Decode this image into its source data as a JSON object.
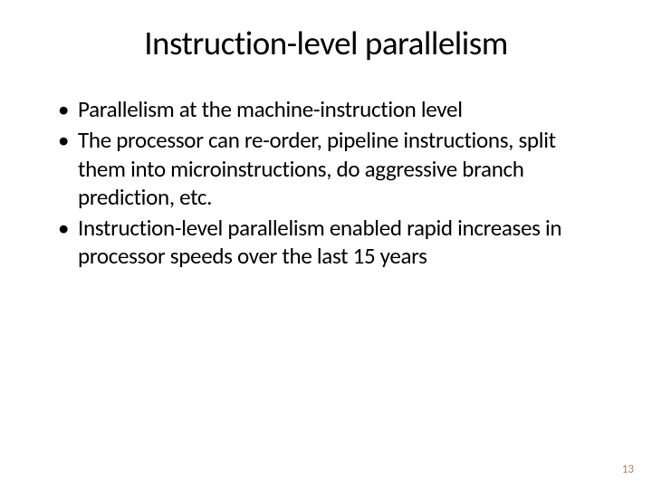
{
  "slide": {
    "title": "Instruction-level parallelism",
    "bullets": [
      "Parallelism at the machine-instruction level",
      "The processor can re-order, pipeline instructions, split them into microinstructions, do aggressive branch prediction, etc.",
      "Instruction-level parallelism enabled rapid increases in processor speeds over the last 15 years"
    ],
    "page_number": "13"
  }
}
